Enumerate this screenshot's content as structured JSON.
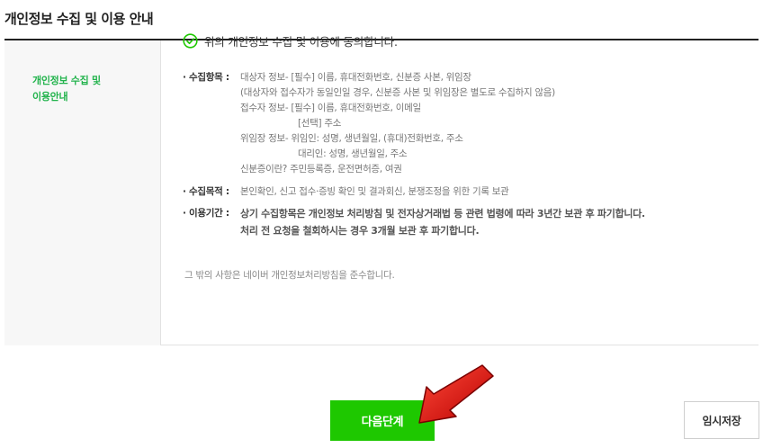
{
  "page": {
    "title": "개인정보 수집 및 이용 안내"
  },
  "side": {
    "label": "개인정보 수집 및\n이용안내"
  },
  "consent": {
    "text": "위의 개인정보 수집 및 이용에 동의합니다."
  },
  "collect": {
    "heading": "· 수집항목 :",
    "lines": [
      "대상자 정보- [필수] 이름, 휴대전화번호, 신분증 사본, 위임장",
      "(대상자와 접수자가 동일인일 경우, 신분증 사본 및 위임장은 별도로 수집하지 않음)",
      "접수자 정보- [필수] 이름, 휴대전화번호, 이메일",
      "[선택] 주소",
      "위임장 정보- 위임인: 성명, 생년월일, (휴대)전화번호, 주소",
      "대리인: 성명, 생년월일, 주소",
      "신분증이란? 주민등록증, 운전면허증, 여권"
    ]
  },
  "purpose": {
    "heading": "· 수집목적 :",
    "text": "본인확인, 신고 접수·증빙 확인 및 결과회신, 분쟁조정을 위한 기록 보관"
  },
  "period": {
    "heading": "· 이용기간 :",
    "line1": "상기 수집항목은 개인정보 처리방침 및 전자상거래법 등 관련 법령에 따라 3년간 보관 후 파기합니다.",
    "line2": "처리 전 요청을 철회하시는 경우 3개월 보관 후 파기합니다."
  },
  "note": {
    "text": "그 밖의 사항은 네이버 개인정보처리방침을 준수합니다."
  },
  "buttons": {
    "next": "다음단계",
    "save": "임시저장"
  },
  "colors": {
    "accent": "#1ec800",
    "label_green": "#22b34c",
    "arrow": "#e01414"
  },
  "icons": {
    "check": "check-circle-icon",
    "arrow": "red-arrow-pointer"
  }
}
